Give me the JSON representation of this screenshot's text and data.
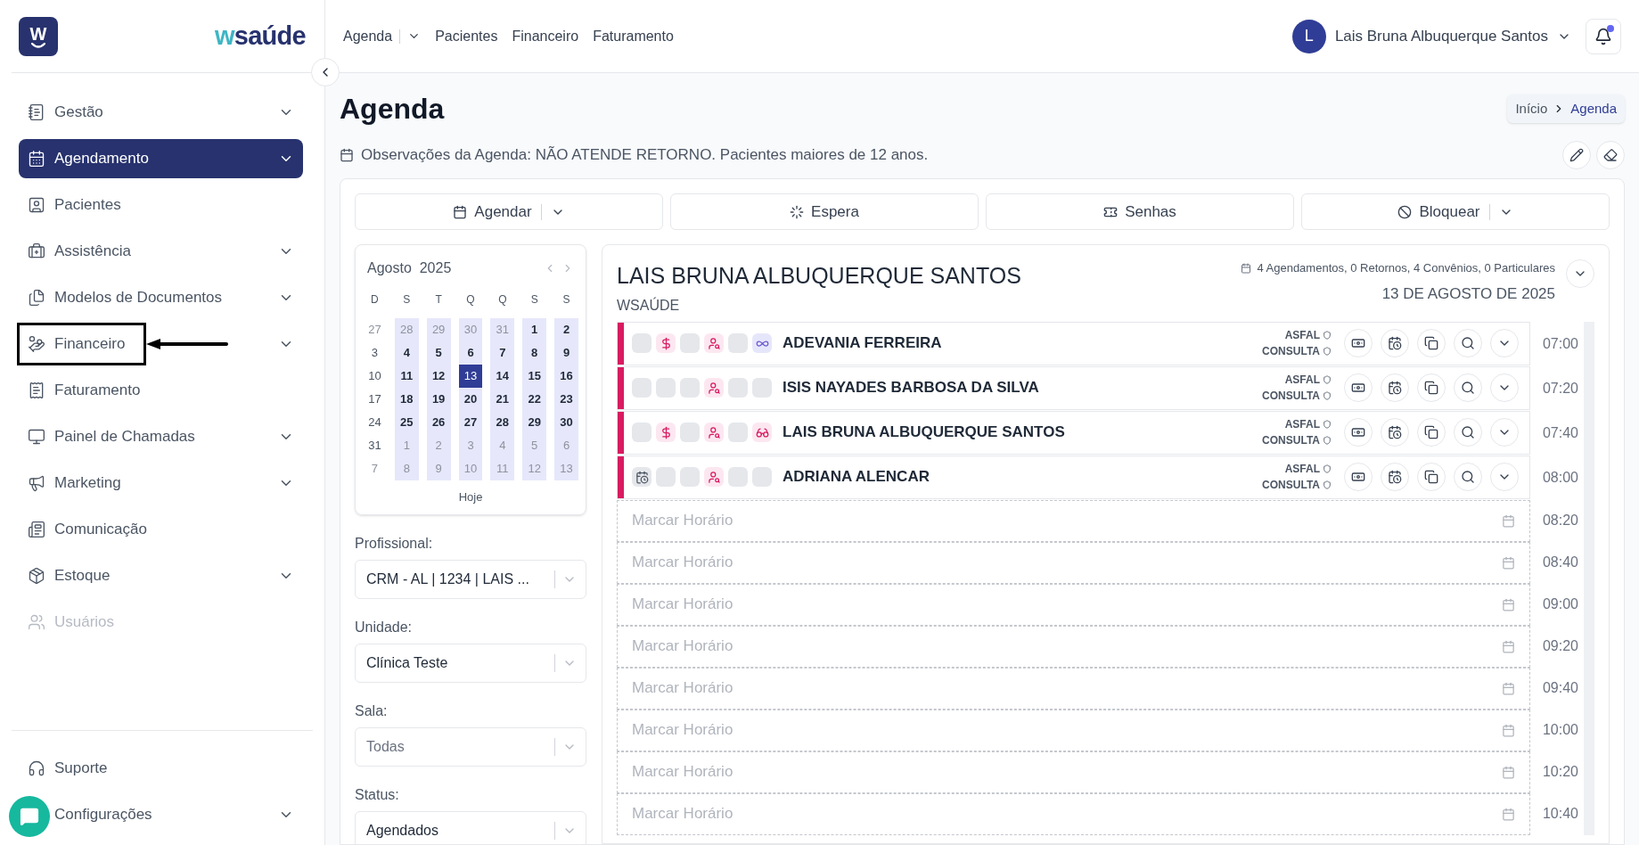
{
  "brand": {
    "mark": "W",
    "wordmark": "wsaúde"
  },
  "sidebar": {
    "items": [
      {
        "label": "Gestão",
        "expandable": true,
        "selected": false,
        "disabled": false,
        "highlighted": false
      },
      {
        "label": "Agendamento",
        "expandable": true,
        "selected": true,
        "disabled": false,
        "highlighted": false
      },
      {
        "label": "Pacientes",
        "expandable": false,
        "selected": false,
        "disabled": false,
        "highlighted": false
      },
      {
        "label": "Assistência",
        "expandable": true,
        "selected": false,
        "disabled": false,
        "highlighted": false
      },
      {
        "label": "Modelos de Documentos",
        "expandable": true,
        "selected": false,
        "disabled": false,
        "highlighted": false
      },
      {
        "label": "Financeiro",
        "expandable": true,
        "selected": false,
        "disabled": false,
        "highlighted": true
      },
      {
        "label": "Faturamento",
        "expandable": false,
        "selected": false,
        "disabled": false,
        "highlighted": false
      },
      {
        "label": "Painel de Chamadas",
        "expandable": true,
        "selected": false,
        "disabled": false,
        "highlighted": false
      },
      {
        "label": "Marketing",
        "expandable": true,
        "selected": false,
        "disabled": false,
        "highlighted": false
      },
      {
        "label": "Comunicação",
        "expandable": false,
        "selected": false,
        "disabled": false,
        "highlighted": false
      },
      {
        "label": "Estoque",
        "expandable": true,
        "selected": false,
        "disabled": false,
        "highlighted": false
      },
      {
        "label": "Usuários",
        "expandable": false,
        "selected": false,
        "disabled": true,
        "highlighted": false
      }
    ],
    "bottom_items": [
      {
        "label": "Suporte",
        "expandable": false
      },
      {
        "label": "Configurações",
        "expandable": true
      }
    ]
  },
  "topnav": [
    {
      "label": "Agenda",
      "dropdown": true
    },
    {
      "label": "Pacientes",
      "dropdown": false
    },
    {
      "label": "Financeiro",
      "dropdown": false
    },
    {
      "label": "Faturamento",
      "dropdown": false
    }
  ],
  "user": {
    "initial": "L",
    "name": "Lais Bruna Albuquerque Santos",
    "notification": true
  },
  "page": {
    "title": "Agenda",
    "breadcrumb": [
      "Início",
      "Agenda"
    ],
    "observations": "Observações da Agenda: NÃO ATENDE RETORNO. Pacientes maiores de 12 anos."
  },
  "actions": [
    {
      "label": "Agendar",
      "dropdown": true
    },
    {
      "label": "Espera",
      "dropdown": false
    },
    {
      "label": "Senhas",
      "dropdown": false
    },
    {
      "label": "Bloquear",
      "dropdown": true
    }
  ],
  "calendar": {
    "month": "Agosto",
    "year": "2025",
    "today_button": "Hoje",
    "weekdays": [
      {
        "label": "D",
        "workday": false
      },
      {
        "label": "S",
        "workday": true
      },
      {
        "label": "T",
        "workday": true
      },
      {
        "label": "Q",
        "workday": true
      },
      {
        "label": "Q",
        "workday": true
      },
      {
        "label": "S",
        "workday": true
      },
      {
        "label": "S",
        "workday": true
      }
    ],
    "weeks": [
      [
        {
          "day": "27",
          "muted": true,
          "selected": false
        },
        {
          "day": "28",
          "muted": true,
          "selected": false
        },
        {
          "day": "29",
          "muted": true,
          "selected": false
        },
        {
          "day": "30",
          "muted": true,
          "selected": false
        },
        {
          "day": "31",
          "muted": true,
          "selected": false
        },
        {
          "day": "1",
          "muted": false,
          "selected": false
        },
        {
          "day": "2",
          "muted": false,
          "selected": false
        }
      ],
      [
        {
          "day": "3",
          "muted": false,
          "selected": false
        },
        {
          "day": "4",
          "muted": false,
          "selected": false
        },
        {
          "day": "5",
          "muted": false,
          "selected": false
        },
        {
          "day": "6",
          "muted": false,
          "selected": false
        },
        {
          "day": "7",
          "muted": false,
          "selected": false
        },
        {
          "day": "8",
          "muted": false,
          "selected": false
        },
        {
          "day": "9",
          "muted": false,
          "selected": false
        }
      ],
      [
        {
          "day": "10",
          "muted": false,
          "selected": false
        },
        {
          "day": "11",
          "muted": false,
          "selected": false
        },
        {
          "day": "12",
          "muted": false,
          "selected": false
        },
        {
          "day": "13",
          "muted": false,
          "selected": true
        },
        {
          "day": "14",
          "muted": false,
          "selected": false
        },
        {
          "day": "15",
          "muted": false,
          "selected": false
        },
        {
          "day": "16",
          "muted": false,
          "selected": false
        }
      ],
      [
        {
          "day": "17",
          "muted": false,
          "selected": false
        },
        {
          "day": "18",
          "muted": false,
          "selected": false
        },
        {
          "day": "19",
          "muted": false,
          "selected": false
        },
        {
          "day": "20",
          "muted": false,
          "selected": false
        },
        {
          "day": "21",
          "muted": false,
          "selected": false
        },
        {
          "day": "22",
          "muted": false,
          "selected": false
        },
        {
          "day": "23",
          "muted": false,
          "selected": false
        }
      ],
      [
        {
          "day": "24",
          "muted": false,
          "selected": false
        },
        {
          "day": "25",
          "muted": false,
          "selected": false
        },
        {
          "day": "26",
          "muted": false,
          "selected": false
        },
        {
          "day": "27",
          "muted": false,
          "selected": false
        },
        {
          "day": "28",
          "muted": false,
          "selected": false
        },
        {
          "day": "29",
          "muted": false,
          "selected": false
        },
        {
          "day": "30",
          "muted": false,
          "selected": false
        }
      ],
      [
        {
          "day": "31",
          "muted": false,
          "selected": false
        },
        {
          "day": "1",
          "muted": true,
          "selected": false
        },
        {
          "day": "2",
          "muted": true,
          "selected": false
        },
        {
          "day": "3",
          "muted": true,
          "selected": false
        },
        {
          "day": "4",
          "muted": true,
          "selected": false
        },
        {
          "day": "5",
          "muted": true,
          "selected": false
        },
        {
          "day": "6",
          "muted": true,
          "selected": false
        }
      ],
      [
        {
          "day": "7",
          "muted": true,
          "selected": false
        },
        {
          "day": "8",
          "muted": true,
          "selected": false
        },
        {
          "day": "9",
          "muted": true,
          "selected": false
        },
        {
          "day": "10",
          "muted": true,
          "selected": false
        },
        {
          "day": "11",
          "muted": true,
          "selected": false
        },
        {
          "day": "12",
          "muted": true,
          "selected": false
        },
        {
          "day": "13",
          "muted": true,
          "selected": false
        }
      ]
    ]
  },
  "filters": [
    {
      "label": "Profissional:",
      "value": "CRM - AL | 1234 | LAIS ..."
    },
    {
      "label": "Unidade:",
      "value": "Clínica Teste"
    },
    {
      "label": "Sala:",
      "placeholder": "Todas"
    },
    {
      "label": "Status:",
      "value": "Agendados"
    }
  ],
  "agenda": {
    "professional": "LAIS BRUNA ALBUQUERQUE SANTOS",
    "unit": "WSAÚDE",
    "summary": "4 Agendamentos, 0 Retornos, 4 Convênios, 0 Particulares",
    "date": "13 DE AGOSTO DE 2025",
    "appointments": [
      {
        "name": "ADEVANIA FERREIRA",
        "plan": "ASFAL",
        "type": "CONSULTA",
        "time": "07:00",
        "color": "#d81b60",
        "status_icons": [
          {
            "kind": "blank"
          },
          {
            "kind": "payment"
          },
          {
            "kind": "blank"
          },
          {
            "kind": "patient"
          },
          {
            "kind": "blank"
          },
          {
            "kind": "infinity"
          }
        ]
      },
      {
        "name": "ISIS NAYADES BARBOSA DA SILVA",
        "plan": "ASFAL",
        "type": "CONSULTA",
        "time": "07:20",
        "color": "#d81b60",
        "status_icons": [
          {
            "kind": "blank"
          },
          {
            "kind": "blank"
          },
          {
            "kind": "blank"
          },
          {
            "kind": "patient"
          },
          {
            "kind": "blank"
          },
          {
            "kind": "blank"
          }
        ]
      },
      {
        "name": "LAIS BRUNA ALBUQUERQUE SANTOS",
        "plan": "ASFAL",
        "type": "CONSULTA",
        "time": "07:40",
        "color": "#d81b60",
        "status_icons": [
          {
            "kind": "blank"
          },
          {
            "kind": "payment"
          },
          {
            "kind": "blank"
          },
          {
            "kind": "patient"
          },
          {
            "kind": "blank"
          },
          {
            "kind": "glasses"
          }
        ]
      },
      {
        "name": "ADRIANA ALENCAR",
        "plan": "ASFAL",
        "type": "CONSULTA",
        "time": "08:00",
        "color": "#d81b60",
        "status_icons": [
          {
            "kind": "reschedule"
          },
          {
            "kind": "blank"
          },
          {
            "kind": "blank"
          },
          {
            "kind": "patient"
          },
          {
            "kind": "blank"
          },
          {
            "kind": "blank"
          }
        ]
      }
    ],
    "free_slots": [
      {
        "label": "Marcar Horário",
        "time": "08:20"
      },
      {
        "label": "Marcar Horário",
        "time": "08:40"
      },
      {
        "label": "Marcar Horário",
        "time": "09:00"
      },
      {
        "label": "Marcar Horário",
        "time": "09:20"
      },
      {
        "label": "Marcar Horário",
        "time": "09:40"
      },
      {
        "label": "Marcar Horário",
        "time": "10:00"
      },
      {
        "label": "Marcar Horário",
        "time": "10:20"
      },
      {
        "label": "Marcar Horário",
        "time": "10:40"
      }
    ]
  }
}
